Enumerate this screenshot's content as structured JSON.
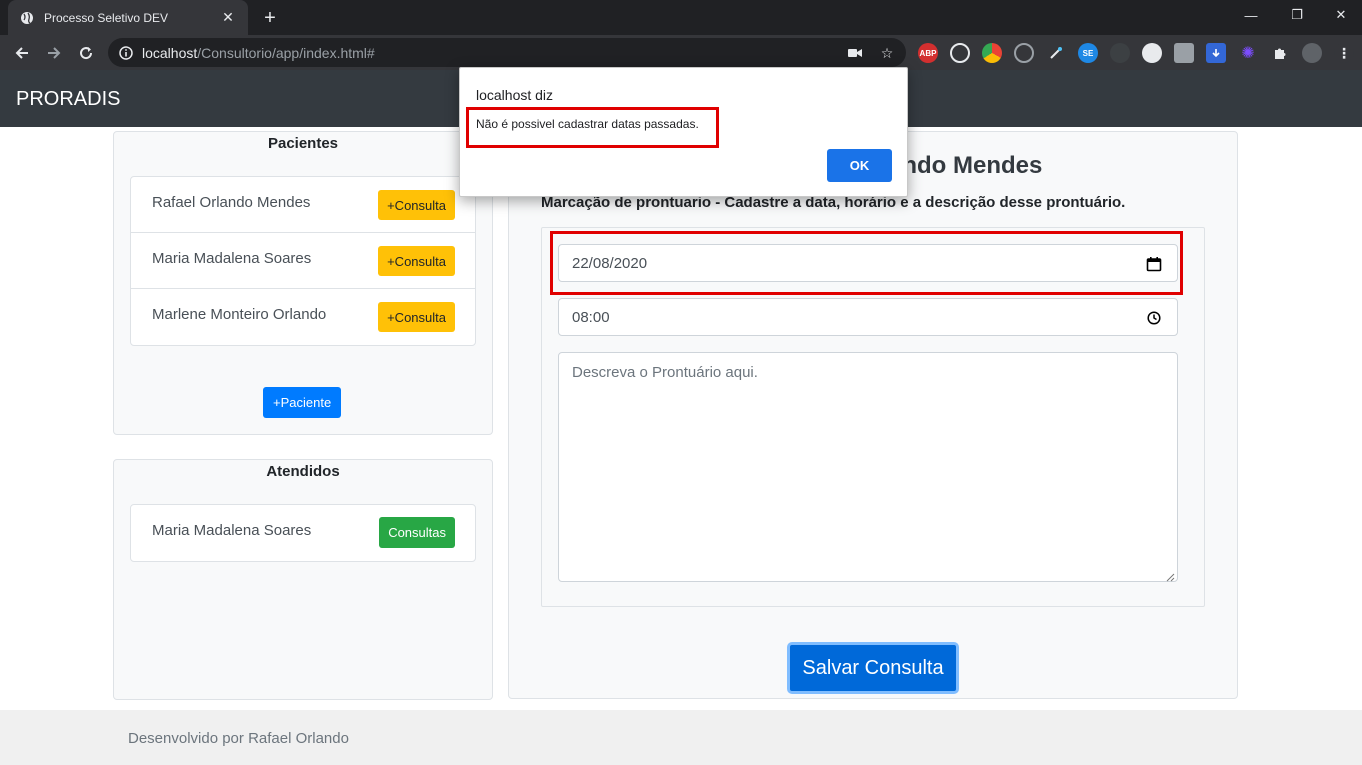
{
  "browser": {
    "tab_title": "Processo Seletivo DEV",
    "url_host": "localhost",
    "url_path": "/Consultorio/app/index.html#",
    "ext_abp": "ABP",
    "ext_se": "SE"
  },
  "app": {
    "brand": "PRORADIS",
    "pacientes": {
      "title": "Pacientes",
      "items": [
        {
          "name": "Rafael Orlando Mendes",
          "action": "+Consulta"
        },
        {
          "name": "Maria Madalena Soares",
          "action": "+Consulta"
        },
        {
          "name": "Marlene Monteiro Orlando",
          "action": "+Consulta"
        }
      ],
      "add_button": "+Paciente"
    },
    "atendidos": {
      "title": "Atendidos",
      "items": [
        {
          "name": "Maria Madalena Soares",
          "action": "Consultas"
        }
      ]
    },
    "form": {
      "heading_visible": "ando Mendes",
      "subheading": "Marcação de prontuario - Cadastre a data, horário e a descrição desse prontuário.",
      "date_value": "22/08/2020",
      "time_value": "08:00",
      "description_placeholder": "Descreva o Prontuário aqui.",
      "save_button": "Salvar Consulta"
    },
    "footer": "Desenvolvido por Rafael Orlando"
  },
  "dialog": {
    "title": "localhost diz",
    "message": "Não é possivel cadastrar datas passadas.",
    "ok_button": "OK"
  },
  "colors": {
    "navbar": "#343a40",
    "warning": "#ffc107",
    "success": "#28a745",
    "primary": "#007bff",
    "highlight": "#e00000"
  }
}
